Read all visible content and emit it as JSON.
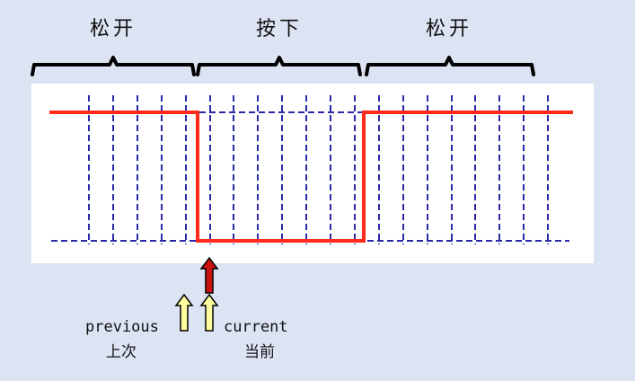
{
  "phases": {
    "released_before": "松开",
    "pressed": "按下",
    "released_after": "松开"
  },
  "markers": {
    "previous_en": "previous",
    "previous_zh": "上次",
    "current_en": "current",
    "current_zh": "当前"
  },
  "colors": {
    "signal": "#ff2a1a",
    "sample_lines": "#2a2aa8",
    "current_arrow": "#cc1111",
    "previous_arrow": "#ffffa0",
    "background": "#dce3f3",
    "plot_bg": "#ffffff"
  }
}
